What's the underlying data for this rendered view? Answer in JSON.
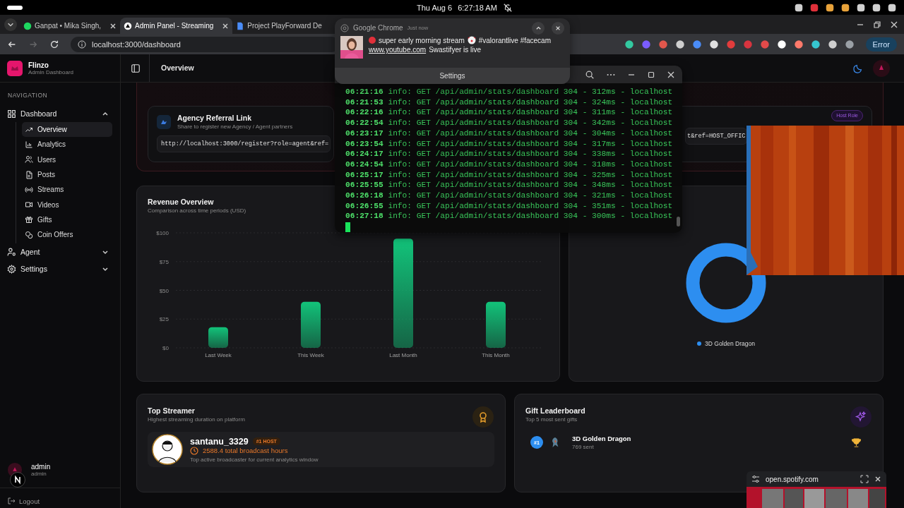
{
  "system_bar": {
    "date": "Thu Aug 6",
    "time": "6:27:18 AM"
  },
  "browser": {
    "tabs": [
      {
        "title": "Ganpat • Mika Singh,",
        "kind": "music",
        "selected": false
      },
      {
        "title": "Admin Panel - Streaming",
        "kind": "app",
        "selected": true
      },
      {
        "title": "Project PlayForward De",
        "kind": "doc",
        "selected": false
      }
    ],
    "url": "localhost:3000/dashboard",
    "error_button": "Error"
  },
  "sidebar": {
    "brand": "Flinzo",
    "subtitle": "Admin Dashboard",
    "section": "NAVIGATION",
    "items": [
      {
        "label": "Dashboard",
        "expanded": true,
        "children": [
          {
            "label": "Overview",
            "selected": true
          },
          {
            "label": "Analytics",
            "selected": false
          },
          {
            "label": "Users",
            "selected": false
          },
          {
            "label": "Posts",
            "selected": false
          },
          {
            "label": "Streams",
            "selected": false
          },
          {
            "label": "Videos",
            "selected": false
          },
          {
            "label": "Gifts",
            "selected": false
          },
          {
            "label": "Coin Offers",
            "selected": false
          }
        ]
      },
      {
        "label": "Agent",
        "expanded": false
      },
      {
        "label": "Settings",
        "expanded": false
      }
    ],
    "user": {
      "name": "admin",
      "role": "admin"
    },
    "logout": "Logout"
  },
  "header": {
    "title": "Overview"
  },
  "referral": {
    "agency": {
      "title": "Agency Referral Link",
      "subtitle": "Share to register new Agency / Agent partners",
      "link": "http://localhost:3000/register?role=agent&ref="
    },
    "host": {
      "badge": "Host Role",
      "link": "t&ref=HOST_OFFIC"
    }
  },
  "revenue": {
    "title": "Revenue Overview",
    "subtitle": "Comparison across time periods (USD)",
    "chart_data": {
      "type": "bar",
      "categories": [
        "Last Week",
        "This Week",
        "Last Month",
        "This Month"
      ],
      "series": [
        {
          "color": "#12c37a",
          "values": [
            18,
            40,
            95,
            40
          ]
        }
      ],
      "ylim": [
        0,
        100
      ],
      "grid": true,
      "yticks": [
        {
          "value": 0,
          "label": "$0"
        },
        {
          "value": 25,
          "label": "$25"
        },
        {
          "value": 50,
          "label": "$50"
        },
        {
          "value": 75,
          "label": "$75"
        },
        {
          "value": 100,
          "label": "$100"
        }
      ]
    }
  },
  "gift_distribution": {
    "legend": [
      {
        "label": "3D Golden Dragon",
        "color": "#2d8ef0"
      }
    ]
  },
  "top_streamer": {
    "title": "Top Streamer",
    "subtitle": "Highest streaming duration on platform",
    "name": "santanu_3329",
    "badge": "#1 HOST",
    "hours": "2588.4 total broadcast hours",
    "note": "Top active broadcaster for current analytics window"
  },
  "gift_leaderboard": {
    "title": "Gift Leaderboard",
    "subtitle": "Top 5 most sent gifts",
    "entries": [
      {
        "rank": "#1",
        "name": "3D Golden Dragon",
        "count": "769 sent"
      }
    ]
  },
  "notification": {
    "app": "Google Chrome",
    "time": "Just now",
    "message_start": "super early morning stream",
    "message_end": "#valorantlive #facecam",
    "site": "www.youtube.com",
    "detail": "Swastifyer is live",
    "settings": "Settings"
  },
  "terminal": {
    "lines": [
      {
        "time": "06:21:16",
        "text": "info: GET /api/admin/stats/dashboard 304 - 312ms - localhost"
      },
      {
        "time": "06:21:53",
        "text": "info: GET /api/admin/stats/dashboard 304 - 324ms - localhost"
      },
      {
        "time": "06:22:16",
        "text": "info: GET /api/admin/stats/dashboard 304 - 311ms - localhost"
      },
      {
        "time": "06:22:54",
        "text": "info: GET /api/admin/stats/dashboard 304 - 342ms - localhost"
      },
      {
        "time": "06:23:17",
        "text": "info: GET /api/admin/stats/dashboard 304 - 304ms - localhost"
      },
      {
        "time": "06:23:54",
        "text": "info: GET /api/admin/stats/dashboard 304 - 317ms - localhost"
      },
      {
        "time": "06:24:17",
        "text": "info: GET /api/admin/stats/dashboard 304 - 338ms - localhost"
      },
      {
        "time": "06:24:54",
        "text": "info: GET /api/admin/stats/dashboard 304 - 318ms - localhost"
      },
      {
        "time": "06:25:17",
        "text": "info: GET /api/admin/stats/dashboard 304 - 325ms - localhost"
      },
      {
        "time": "06:25:55",
        "text": "info: GET /api/admin/stats/dashboard 304 - 348ms - localhost"
      },
      {
        "time": "06:26:18",
        "text": "info: GET /api/admin/stats/dashboard 304 - 321ms - localhost"
      },
      {
        "time": "06:26:55",
        "text": "info: GET /api/admin/stats/dashboard 304 - 351ms - localhost"
      },
      {
        "time": "06:27:18",
        "text": "info: GET /api/admin/stats/dashboard 304 - 300ms - localhost"
      }
    ]
  },
  "pip": {
    "site": "open.spotify.com"
  }
}
